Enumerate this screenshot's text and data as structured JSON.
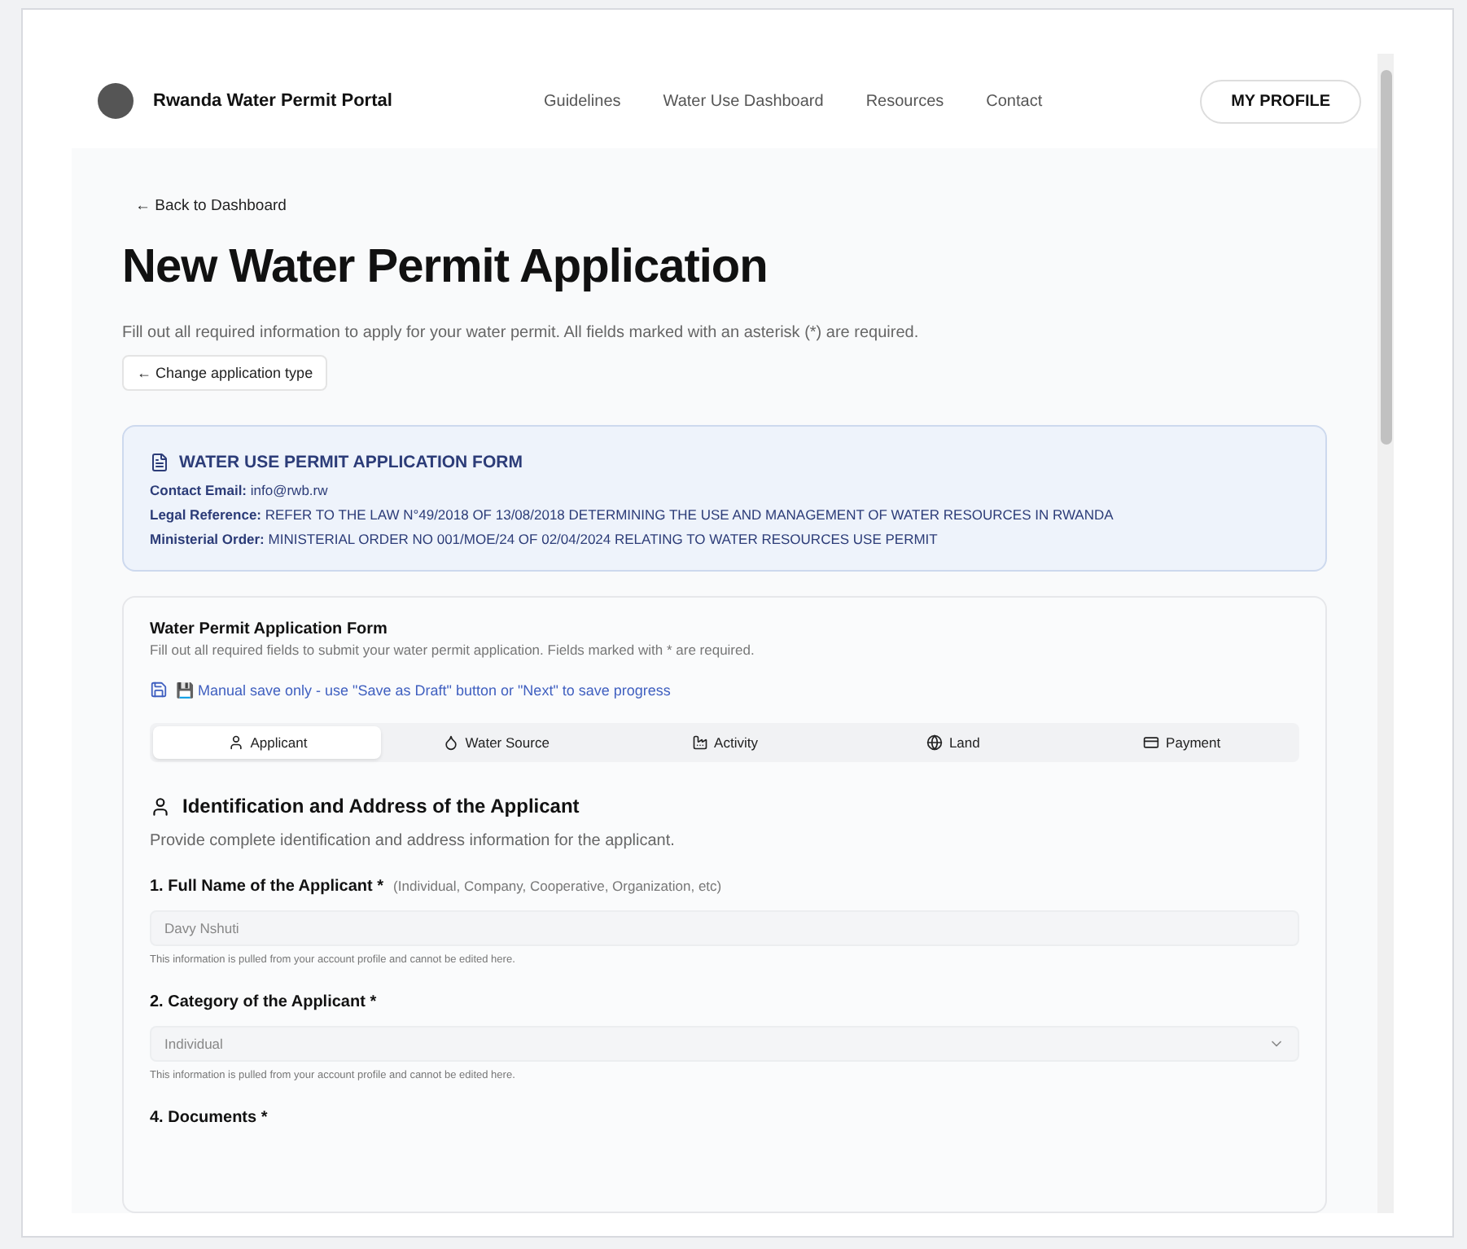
{
  "header": {
    "brand": "Rwanda Water Permit Portal",
    "nav": [
      "Guidelines",
      "Water Use Dashboard",
      "Resources",
      "Contact"
    ],
    "profile_button": "MY PROFILE"
  },
  "back_link": "← Back to Dashboard",
  "title": "New Water Permit Application",
  "intro": "Fill out all required information to apply for your water permit. All fields marked with an asterisk (*) are required.",
  "change_type_button": "← Change application type",
  "info_box": {
    "title": "WATER USE PERMIT APPLICATION FORM",
    "lines": [
      {
        "label": "Contact Email:",
        "value": "info@rwb.rw"
      },
      {
        "label": "Legal Reference:",
        "value": "REFER TO THE LAW N°49/2018 OF 13/08/2018 DETERMINING THE USE AND MANAGEMENT OF WATER RESOURCES IN RWANDA"
      },
      {
        "label": "Ministerial Order:",
        "value": "MINISTERIAL ORDER NO 001/MOE/24 OF 02/04/2024 RELATING TO WATER RESOURCES USE PERMIT"
      }
    ]
  },
  "form": {
    "title": "Water Permit Application Form",
    "subtitle": "Fill out all required fields to submit your water permit application. Fields marked with * are required.",
    "save_note": "💾 Manual save only - use \"Save as Draft\" button or \"Next\" to save progress",
    "tabs": [
      {
        "label": "Applicant",
        "kind": "user",
        "selected": true
      },
      {
        "label": "Water Source",
        "kind": "drop",
        "selected": false
      },
      {
        "label": "Activity",
        "kind": "factory",
        "selected": false
      },
      {
        "label": "Land",
        "kind": "globe",
        "selected": false
      },
      {
        "label": "Payment",
        "kind": "card",
        "selected": false
      }
    ],
    "section_title": "Identification and Address of the Applicant",
    "section_subtitle": "Provide complete identification and address information for the applicant.",
    "fields": [
      {
        "kind": "text",
        "label": "1. Full Name of the Applicant *",
        "note": "(Individual, Company, Cooperative, Organization, etc)",
        "value": "Davy Nshuti",
        "disabled": true,
        "help": "This information is pulled from your account profile and cannot be edited here."
      },
      {
        "kind": "select",
        "label": "2. Category of the Applicant *",
        "value": "Individual",
        "disabled": true,
        "help": "This information is pulled from your account profile and cannot be edited here."
      },
      {
        "kind": "heading",
        "label": "4. Documents *"
      }
    ]
  }
}
